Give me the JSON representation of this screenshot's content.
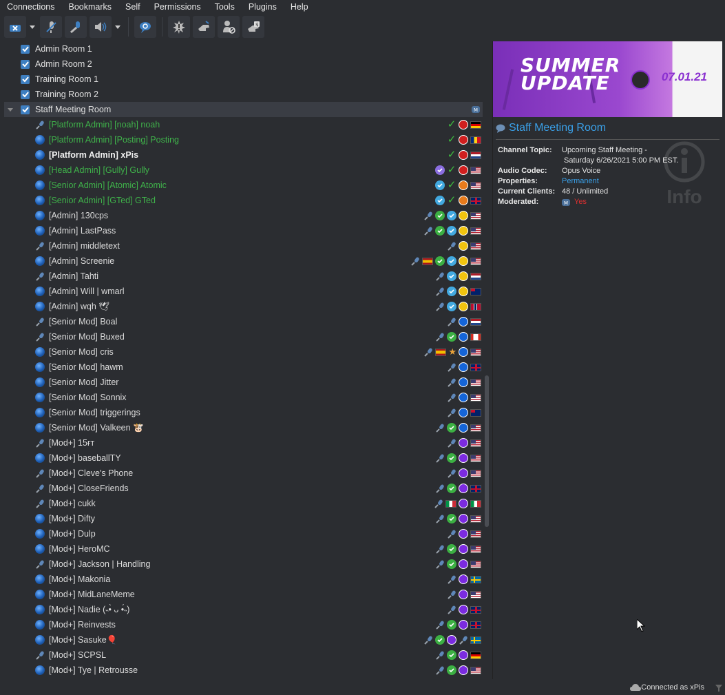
{
  "menu": [
    "Connections",
    "Bookmarks",
    "Self",
    "Permissions",
    "Tools",
    "Plugins",
    "Help"
  ],
  "channels": [
    {
      "name": "Admin Room 1"
    },
    {
      "name": "Admin Room 2"
    },
    {
      "name": "Training Room 1"
    },
    {
      "name": "Training Room 2"
    },
    {
      "name": "Staff Meeting Room",
      "expanded": true,
      "selected": true
    }
  ],
  "clients": [
    {
      "name": "[Platform Admin] [noah] noah",
      "style": "green",
      "icon": "mic",
      "badges": [
        "check",
        "red",
        "flag-de"
      ]
    },
    {
      "name": "[Platform Admin] [Posting] Posting",
      "style": "green",
      "icon": "idle",
      "badges": [
        "check",
        "red",
        "flag-ro"
      ]
    },
    {
      "name": "[Platform Admin] xPis",
      "style": "bold",
      "icon": "idle",
      "badges": [
        "check",
        "red",
        "flag-nl"
      ]
    },
    {
      "name": "[Head Admin] [Gully] Gully",
      "style": "green",
      "icon": "idle",
      "badges": [
        "violet",
        "check",
        "red",
        "flag-us"
      ]
    },
    {
      "name": "[Senior Admin] [Atomic] Atomic",
      "style": "green",
      "icon": "idle",
      "badges": [
        "cyan",
        "check",
        "orange",
        "flag-us"
      ]
    },
    {
      "name": "[Senior Admin] [GTed] GTed",
      "style": "green",
      "icon": "idle",
      "badges": [
        "cyan",
        "check",
        "orange",
        "flag-gb"
      ]
    },
    {
      "name": "[Admin] 130cps",
      "style": "",
      "icon": "idle",
      "badges": [
        "mic",
        "green",
        "cyan",
        "yellow",
        "flag-us"
      ]
    },
    {
      "name": "[Admin] LastPass",
      "style": "",
      "icon": "idle",
      "badges": [
        "mic",
        "green",
        "cyan",
        "yellow",
        "flag-us"
      ]
    },
    {
      "name": "[Admin] middletext",
      "style": "",
      "icon": "mic",
      "badges": [
        "mic",
        "yellow",
        "flag-us"
      ]
    },
    {
      "name": "[Admin] Screenie",
      "style": "",
      "icon": "idle",
      "badges": [
        "mic",
        "flag-es",
        "green",
        "cyan",
        "yellow",
        "flag-us"
      ]
    },
    {
      "name": "[Admin] Tahti",
      "style": "",
      "icon": "mic",
      "badges": [
        "mic",
        "cyan",
        "yellow",
        "flag-nl"
      ]
    },
    {
      "name": "[Admin] Will | wmarl",
      "style": "",
      "icon": "idle",
      "badges": [
        "mic",
        "cyan",
        "yellow",
        "flag-au"
      ]
    },
    {
      "name": "[Admin] wqh 🕊",
      "style": "",
      "icon": "idle",
      "badges": [
        "mic",
        "cyan",
        "yellow",
        "flag-no"
      ]
    },
    {
      "name": "[Senior Mod] Boal",
      "style": "",
      "icon": "mic",
      "badges": [
        "mic",
        "blue",
        "flag-nl"
      ]
    },
    {
      "name": "[Senior Mod] Buxed",
      "style": "",
      "icon": "mic",
      "badges": [
        "mic",
        "green",
        "blue",
        "flag-ca"
      ]
    },
    {
      "name": "[Senior Mod] cris",
      "style": "",
      "icon": "idle",
      "badges": [
        "mic",
        "flag-es",
        "star",
        "blue",
        "flag-us"
      ]
    },
    {
      "name": "[Senior Mod] hawm",
      "style": "",
      "icon": "idle",
      "badges": [
        "mic",
        "blue",
        "flag-gb"
      ]
    },
    {
      "name": "[Senior Mod] Jitter",
      "style": "",
      "icon": "idle",
      "badges": [
        "mic",
        "blue",
        "flag-us"
      ]
    },
    {
      "name": "[Senior Mod] Sonnix",
      "style": "",
      "icon": "idle",
      "badges": [
        "mic",
        "blue",
        "flag-us"
      ]
    },
    {
      "name": "[Senior Mod] triggerings",
      "style": "",
      "icon": "idle",
      "badges": [
        "mic",
        "blue",
        "flag-au"
      ]
    },
    {
      "name": "[Senior Mod] Valkeen 🐮",
      "style": "",
      "icon": "idle",
      "badges": [
        "mic",
        "green",
        "blue",
        "flag-us"
      ]
    },
    {
      "name": "[Mod+] 15ғт",
      "style": "",
      "icon": "mic",
      "badges": [
        "mic",
        "purple",
        "flag-us"
      ]
    },
    {
      "name": "[Mod+] baseballTY",
      "style": "",
      "icon": "idle",
      "badges": [
        "mic",
        "green",
        "purple",
        "flag-us"
      ]
    },
    {
      "name": "[Mod+] Cleve's Phone",
      "style": "",
      "icon": "mic",
      "badges": [
        "mic",
        "purple",
        "flag-us"
      ]
    },
    {
      "name": "[Mod+] CloseFriends",
      "style": "",
      "icon": "mic",
      "badges": [
        "mic",
        "green",
        "purple",
        "flag-gb"
      ]
    },
    {
      "name": "[Mod+] cukk",
      "style": "",
      "icon": "mic",
      "badges": [
        "mic",
        "flag-it",
        "purple",
        "flag-it"
      ]
    },
    {
      "name": "[Mod+] Difty",
      "style": "",
      "icon": "idle",
      "badges": [
        "mic",
        "green",
        "purple",
        "flag-us"
      ]
    },
    {
      "name": "[Mod+] Dulp",
      "style": "",
      "icon": "idle",
      "badges": [
        "mic",
        "purple",
        "flag-us"
      ]
    },
    {
      "name": "[Mod+] HeroMC",
      "style": "",
      "icon": "idle",
      "badges": [
        "mic",
        "green",
        "purple",
        "flag-us"
      ]
    },
    {
      "name": "[Mod+] Jackson | Handling",
      "style": "",
      "icon": "mic",
      "badges": [
        "mic",
        "green",
        "purple",
        "flag-us"
      ]
    },
    {
      "name": "[Mod+] Makonia",
      "style": "",
      "icon": "idle",
      "badges": [
        "mic",
        "purple",
        "flag-se"
      ]
    },
    {
      "name": "[Mod+] MidLaneMeme",
      "style": "",
      "icon": "idle",
      "badges": [
        "mic",
        "purple",
        "flag-us"
      ]
    },
    {
      "name": "[Mod+] Nadie (˵•̀ ᴗ •́˵)",
      "style": "",
      "icon": "idle",
      "badges": [
        "mic",
        "purple",
        "flag-gb"
      ]
    },
    {
      "name": "[Mod+] Reinvests",
      "style": "",
      "icon": "idle",
      "badges": [
        "mic",
        "green",
        "purple",
        "flag-gb"
      ]
    },
    {
      "name": "[Mod+] Sasuke🎈",
      "style": "",
      "icon": "idle",
      "badges": [
        "mic",
        "green",
        "purple",
        "mic",
        "flag-se"
      ]
    },
    {
      "name": "[Mod+] SCPSL",
      "style": "",
      "icon": "mic",
      "badges": [
        "mic",
        "green",
        "purple",
        "flag-de"
      ]
    },
    {
      "name": "[Mod+] Tye | Retrousse",
      "style": "",
      "icon": "idle",
      "badges": [
        "mic",
        "green",
        "purple",
        "flag-us"
      ]
    }
  ],
  "banner": {
    "line1": "SUMMER",
    "line2": "UPDATE",
    "date": "07.01.21"
  },
  "info": {
    "title": "Staff Meeting Room",
    "rows": [
      {
        "key": "Channel Topic:",
        "value": "Upcoming Staff Meeting -",
        "value2": " Saturday 6/26/2021 5:00 PM EST.",
        "style": ""
      },
      {
        "key": "Audio Codec:",
        "value": "Opus Voice",
        "style": ""
      },
      {
        "key": "Properties:",
        "value": "Permanent",
        "style": "link"
      },
      {
        "key": "Current Clients:",
        "value": "48 / Unlimited",
        "style": ""
      },
      {
        "key": "Moderated:",
        "value": "Yes",
        "style": "red"
      }
    ],
    "watermark": "Info"
  },
  "status": {
    "text": "Connected as xPis"
  },
  "colors": {
    "accent": "#3aa0e8",
    "green_name": "#3fb24a",
    "background": "#2b2d31"
  }
}
